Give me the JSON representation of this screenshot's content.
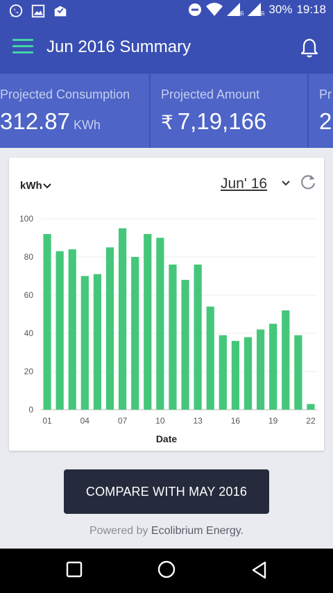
{
  "status_bar": {
    "battery_percent": "30%",
    "time": "19:18",
    "icons": [
      "whatsapp-icon",
      "image-icon",
      "mail-check-icon",
      "do-not-disturb-icon",
      "wifi-icon",
      "signal-icon",
      "signal-icon"
    ]
  },
  "app_bar": {
    "title": "Jun 2016 Summary",
    "menu_icon": "menu-icon",
    "bell_icon": "bell-icon"
  },
  "summary": [
    {
      "label": "Projected Consumption",
      "value": "312.87",
      "unit": "KWh"
    },
    {
      "label": "Projected Amount",
      "currency": "₹",
      "value": "7,19,166"
    },
    {
      "label": "Pr",
      "value": "2"
    }
  ],
  "chart": {
    "unit_selector": "kWh",
    "month_selector": "Jun' 16"
  },
  "chart_data": {
    "type": "bar",
    "xlabel": "Date",
    "ylabel": "",
    "ylim": [
      0,
      100
    ],
    "yticks": [
      0,
      20,
      40,
      60,
      80,
      100
    ],
    "tick_labels": [
      "01",
      "04",
      "07",
      "10",
      "13",
      "16",
      "19",
      "22"
    ],
    "categories": [
      "01",
      "02",
      "03",
      "04",
      "05",
      "06",
      "07",
      "08",
      "09",
      "10",
      "11",
      "12",
      "13",
      "14",
      "15",
      "16",
      "17",
      "18",
      "19",
      "20",
      "21",
      "22"
    ],
    "values": [
      92,
      83,
      84,
      70,
      71,
      85,
      95,
      80,
      92,
      90,
      76,
      68,
      76,
      54,
      39,
      36,
      38,
      42,
      45,
      52,
      39,
      3
    ],
    "grid": true,
    "bar_color": "#45c77b"
  },
  "compare_button": "COMPARE WITH MAY 2016",
  "footer": {
    "powered_by": "Powered by",
    "brand": "Ecolibrium Energy."
  },
  "colors": {
    "app_bar": "#3a4fb3",
    "summary_bg": "#4e64c6",
    "accent": "#43d6a4",
    "button": "#252a3c"
  }
}
